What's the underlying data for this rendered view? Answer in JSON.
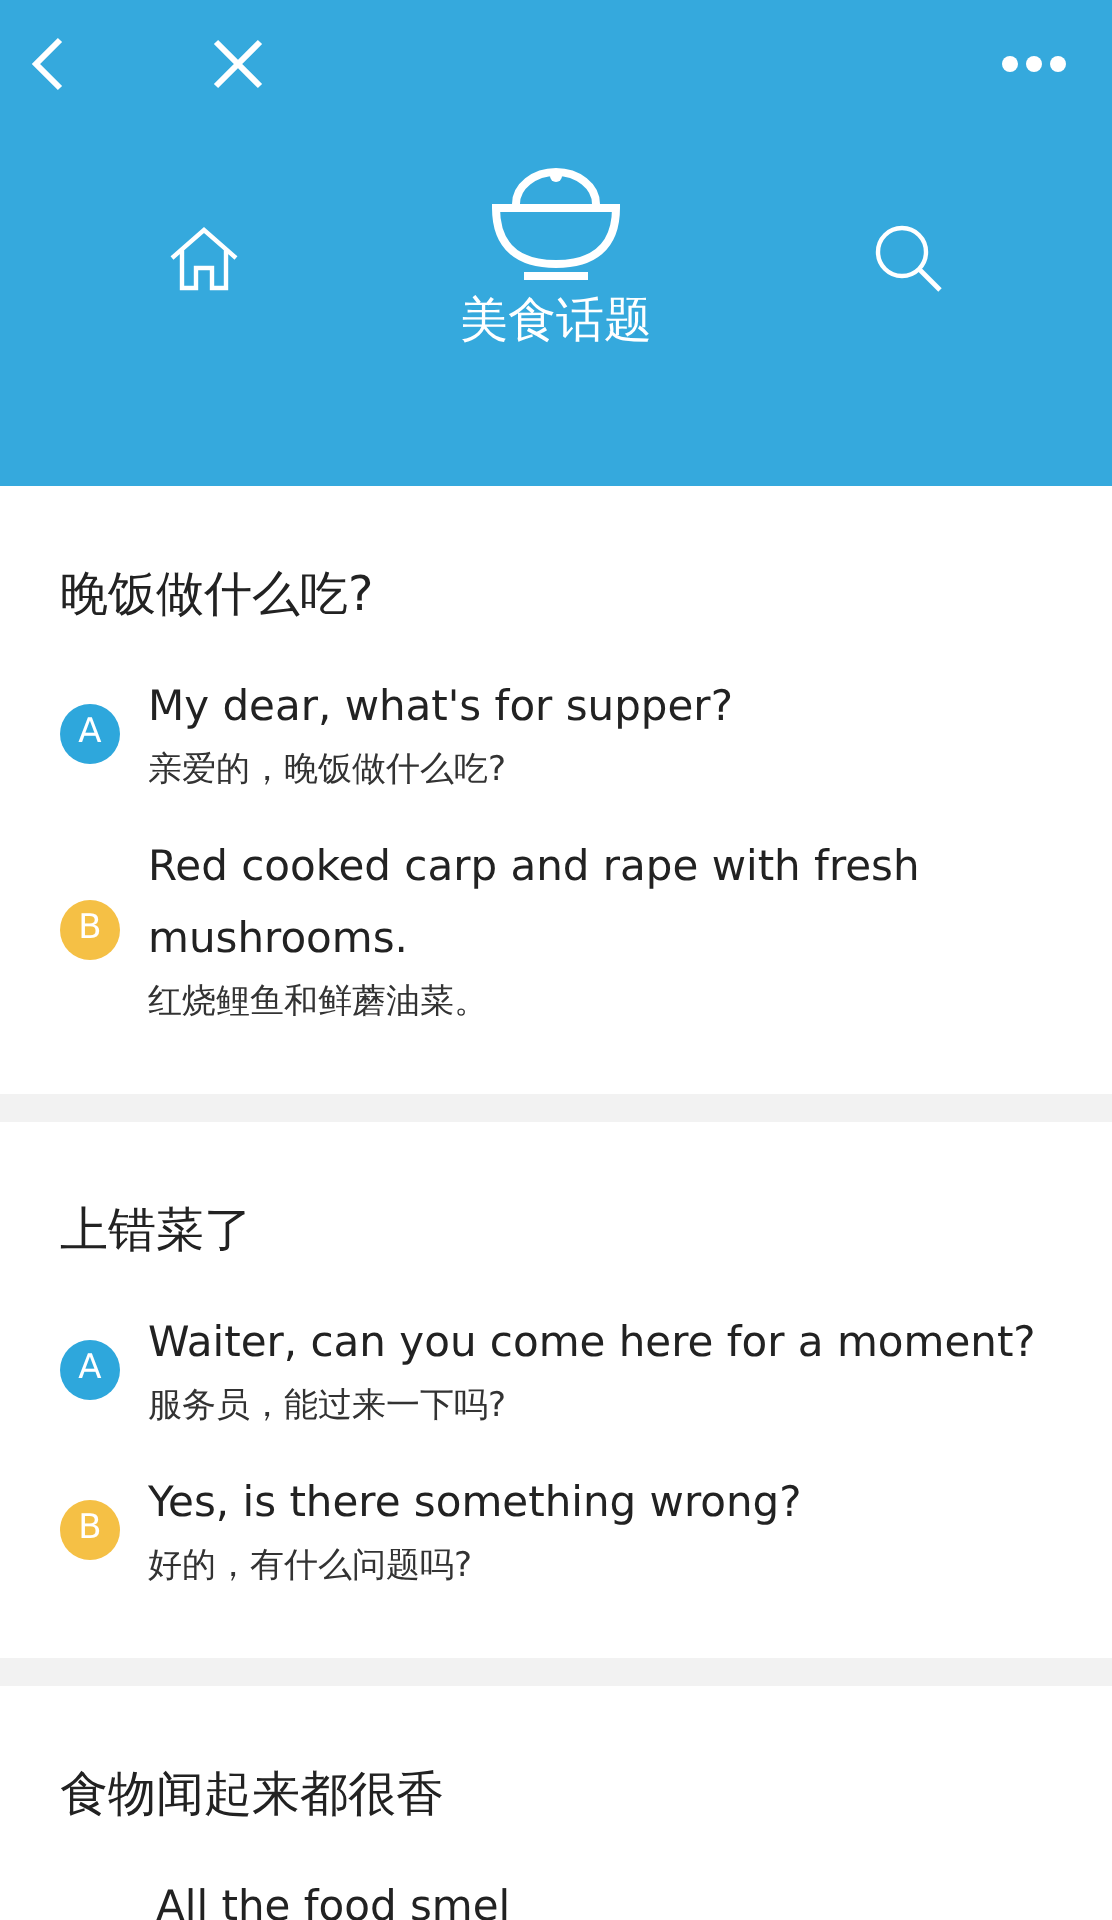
{
  "header": {
    "title": "美食话题"
  },
  "sections": [
    {
      "title": "晚饭做什么吃?",
      "lines": [
        {
          "speaker": "A",
          "color": "#2ea7dc",
          "english": "My dear, what's for supper?",
          "chinese": "亲爱的，晚饭做什么吃?"
        },
        {
          "speaker": "B",
          "color": "#f5c045",
          "english": "Red cooked carp and rape with fresh mushrooms.",
          "chinese": "红烧鲤鱼和鲜蘑油菜。"
        }
      ]
    },
    {
      "title": "上错菜了",
      "lines": [
        {
          "speaker": "A",
          "color": "#2ea7dc",
          "english": "Waiter, can you come here for a moment?",
          "chinese": "服务员，能过来一下吗?"
        },
        {
          "speaker": "B",
          "color": "#f5c045",
          "english": "Yes, is there something wrong?",
          "chinese": "好的，有什么问题吗?"
        }
      ]
    },
    {
      "title": "食物闻起来都很香",
      "lines": [
        {
          "english": "All the food smel"
        }
      ]
    }
  ]
}
